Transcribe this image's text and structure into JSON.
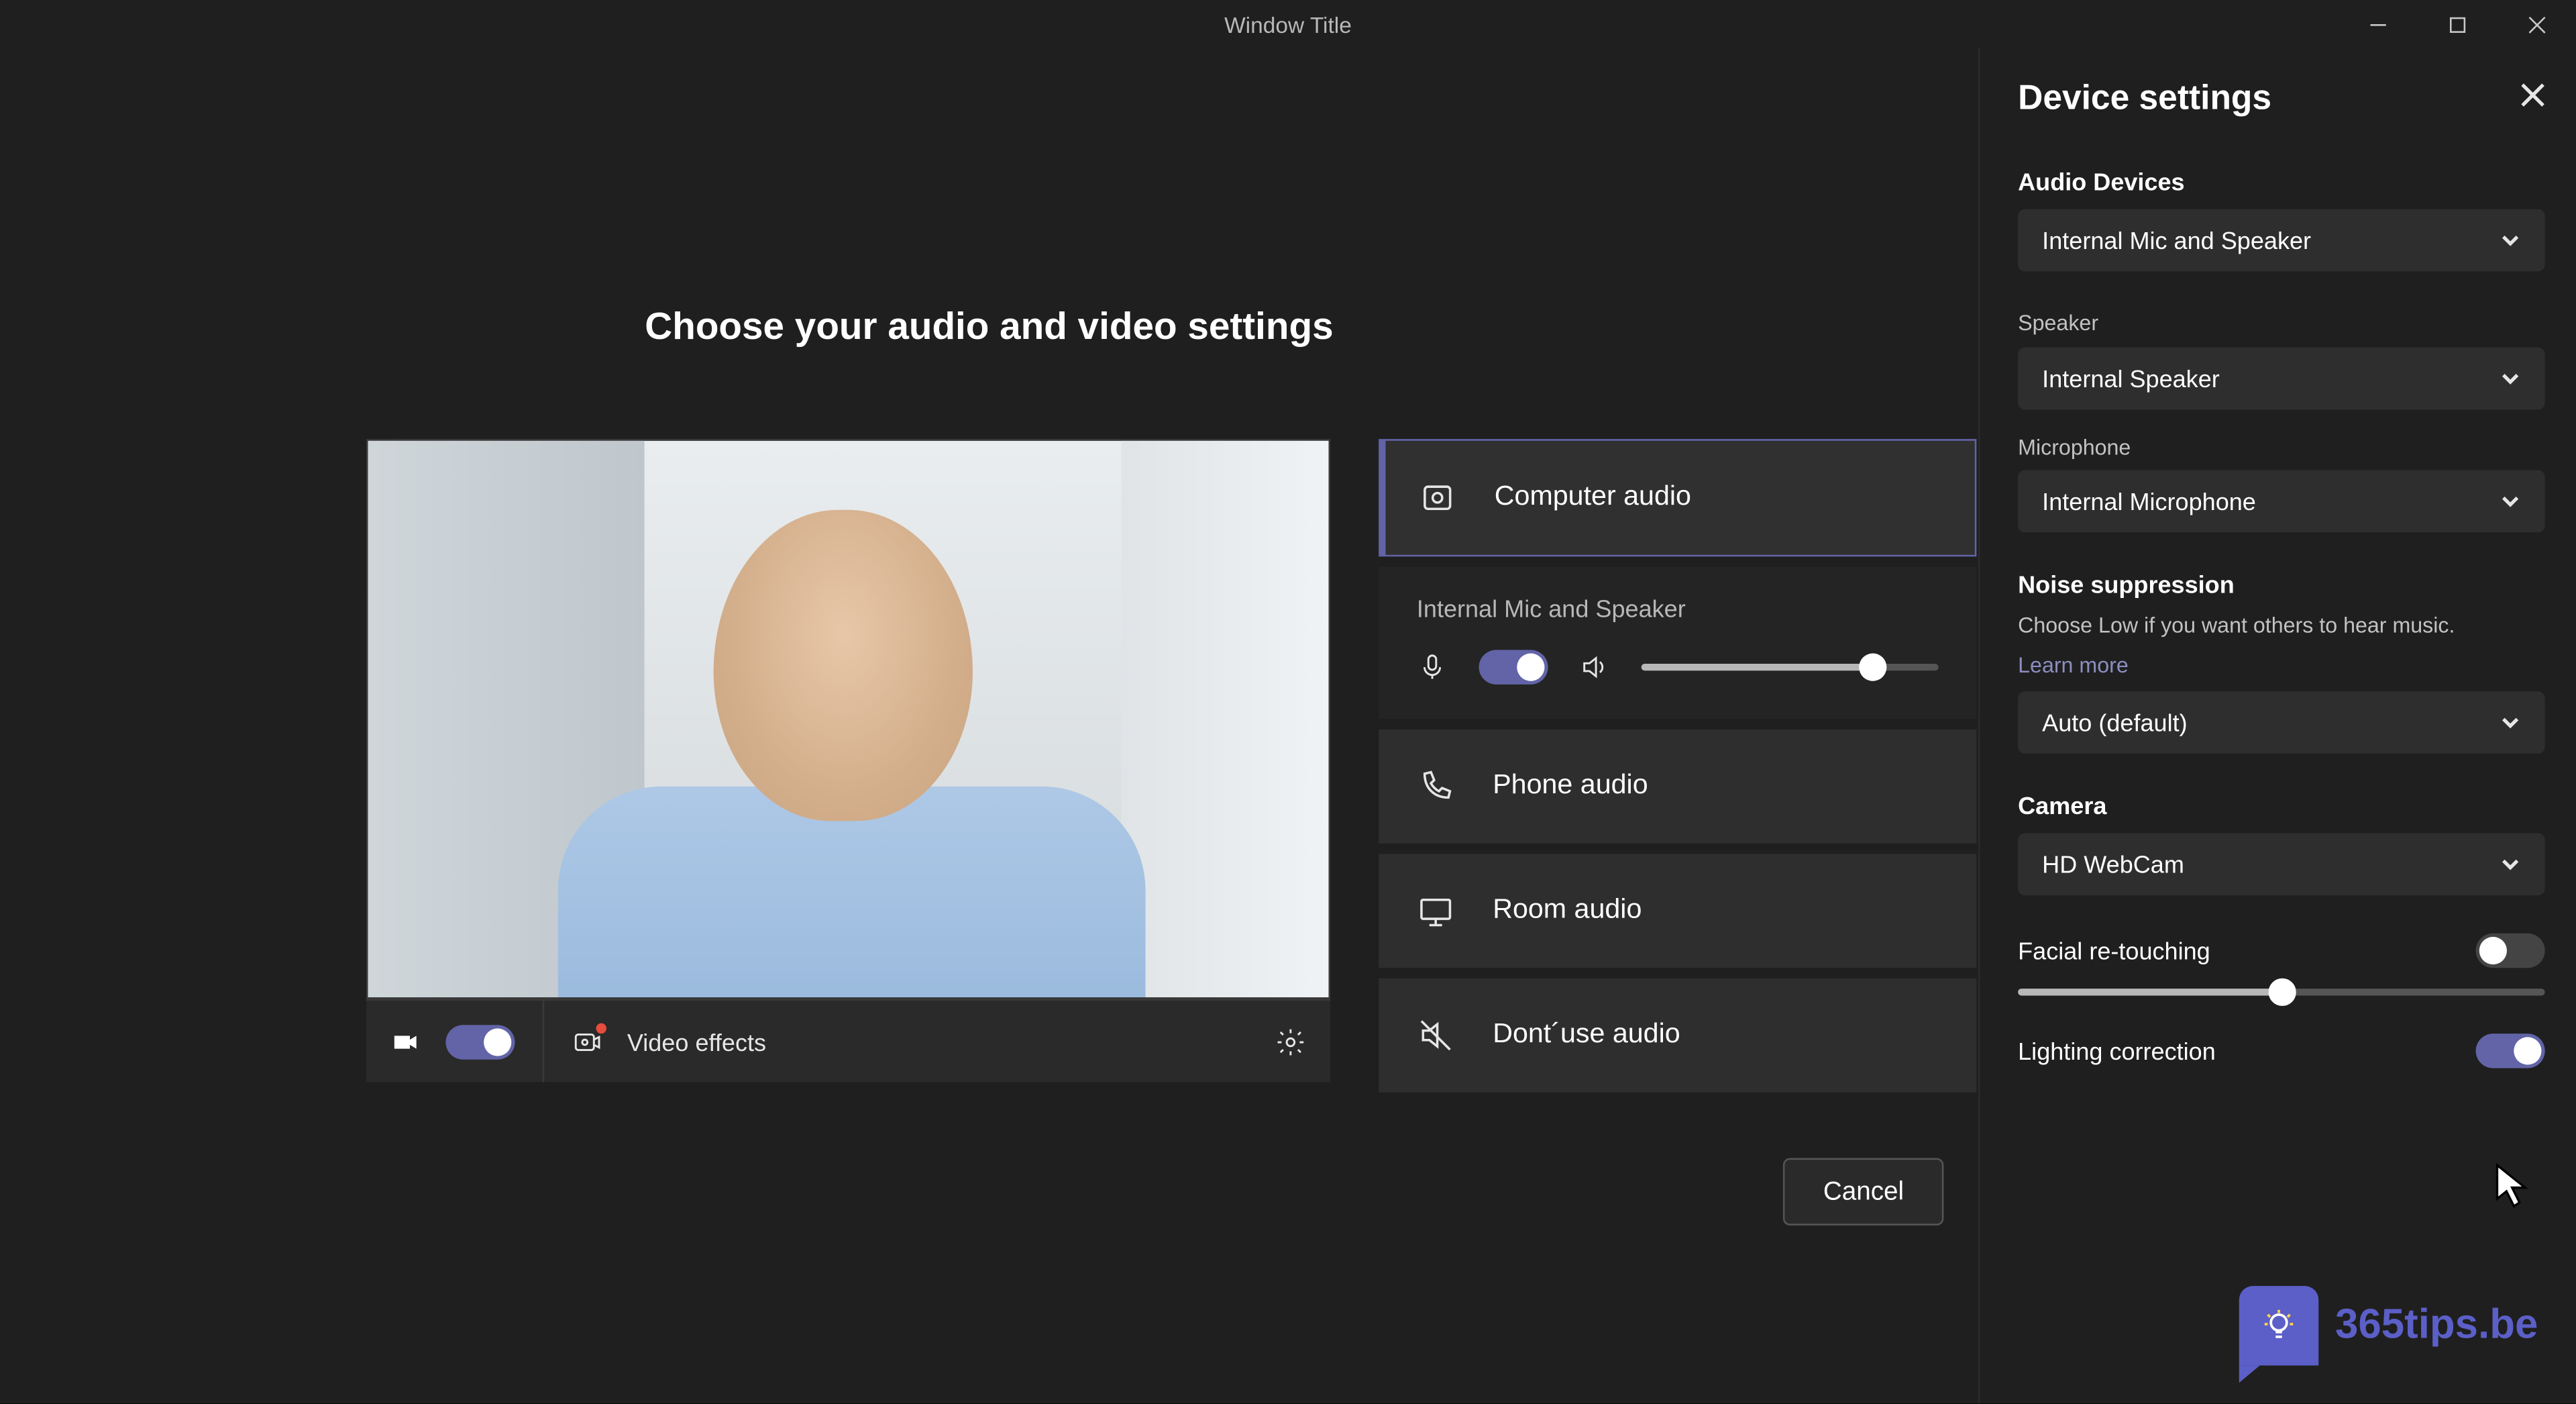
{
  "window": {
    "title": "Window Title"
  },
  "main": {
    "heading": "Choose your audio and video settings",
    "video_toolbar": {
      "effects_label": "Video effects",
      "camera_toggle_on": true
    },
    "audio_options": {
      "computer": "Computer audio",
      "phone": "Phone audio",
      "room": "Room audio",
      "none": "Dont´use audio"
    },
    "audio_sub": {
      "device_label": "Internal Mic and Speaker",
      "mic_toggle_on": true,
      "volume_percent": 78
    },
    "buttons": {
      "cancel": "Cancel"
    }
  },
  "panel": {
    "title": "Device settings",
    "audio_devices": {
      "label": "Audio Devices",
      "value": "Internal Mic and Speaker"
    },
    "speaker": {
      "label": "Speaker",
      "value": "Internal Speaker"
    },
    "microphone": {
      "label": "Microphone",
      "value": "Internal Microphone"
    },
    "noise_suppression": {
      "label": "Noise suppression",
      "hint": "Choose Low if you want others to hear music.",
      "learn_more": "Learn more",
      "value": "Auto (default)"
    },
    "camera": {
      "label": "Camera",
      "value": "HD WebCam"
    },
    "facial": {
      "label": "Facial re-touching",
      "on": false,
      "slider_percent": 50
    },
    "lighting": {
      "label": "Lighting correction",
      "on": true
    }
  },
  "watermark": {
    "text": "365tips.be"
  }
}
